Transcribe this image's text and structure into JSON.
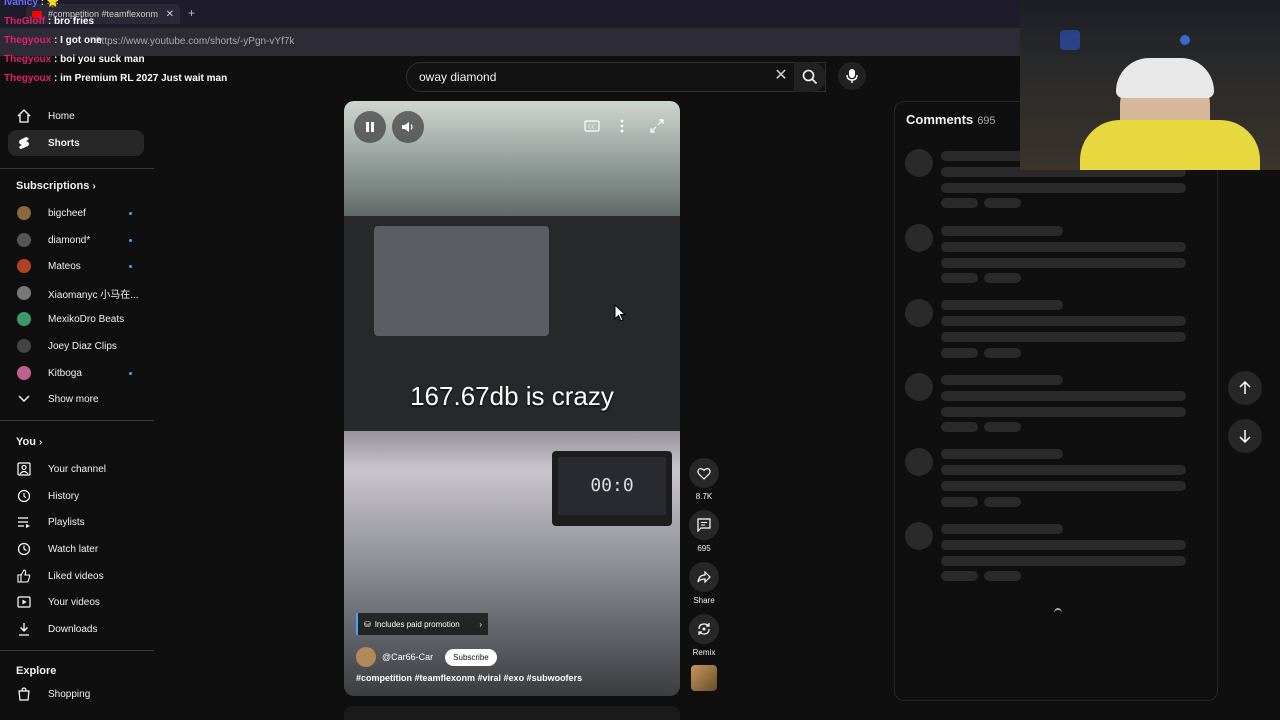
{
  "browser": {
    "tab_title": "#competition #teamflexonm",
    "new_tab": "+",
    "url": "https://www.youtube.com/shorts/-yPgn-vYf7k"
  },
  "chat": [
    {
      "user": "Ivanicy",
      "message": "🌟"
    },
    {
      "user": "TheGloff",
      "message": "bro fries"
    },
    {
      "user": "Thegyoux",
      "message": "I got one"
    },
    {
      "user": "Thegyoux",
      "message": "boi you suck man"
    },
    {
      "user": "Thegyoux",
      "message": "im Premium RL 2027 Just wait man"
    }
  ],
  "search": {
    "value": "oway diamond"
  },
  "sidebar": {
    "main": [
      {
        "label": "Home",
        "icon": "home-icon"
      },
      {
        "label": "Shorts",
        "icon": "shorts-icon",
        "active": true
      }
    ],
    "subscriptions_header": "Subscriptions",
    "subscriptions": [
      {
        "label": "bigcheef",
        "color": "#8a6a3a",
        "dot": true
      },
      {
        "label": "diamond*",
        "color": "#555555",
        "dot": true
      },
      {
        "label": "Mateos",
        "color": "#b04020",
        "dot": true
      },
      {
        "label": "Xiaomanyc 小马在...",
        "color": "#777777",
        "dot": false
      },
      {
        "label": "MexikoDro Beats",
        "color": "#3a9a6a",
        "dot": false
      },
      {
        "label": "Joey Diaz Clips",
        "color": "#444444",
        "dot": false
      },
      {
        "label": "Kitboga",
        "color": "#c06090",
        "dot": true
      }
    ],
    "show_more": "Show more",
    "you_header": "You",
    "you": [
      {
        "label": "Your channel",
        "icon": "channel-icon"
      },
      {
        "label": "History",
        "icon": "history-icon"
      },
      {
        "label": "Playlists",
        "icon": "playlists-icon"
      },
      {
        "label": "Watch later",
        "icon": "watch-later-icon"
      },
      {
        "label": "Liked videos",
        "icon": "like-icon"
      },
      {
        "label": "Your videos",
        "icon": "your-videos-icon"
      },
      {
        "label": "Downloads",
        "icon": "download-icon"
      }
    ],
    "explore_header": "Explore",
    "explore": [
      {
        "label": "Shopping",
        "icon": "shopping-icon"
      }
    ]
  },
  "video": {
    "caption": "167.67db is crazy",
    "laptop_display": "00:0",
    "promo": "Includes paid promotion",
    "channel": "@Car66-Car",
    "subscribe": "Subscribe",
    "tags": "#competition #teamflexonm #viral #exo #subwoofers"
  },
  "actions": {
    "likes": "8.7K",
    "comments": "695",
    "share": "Share",
    "remix": "Remix"
  },
  "comments": {
    "title": "Comments",
    "count": "695"
  }
}
